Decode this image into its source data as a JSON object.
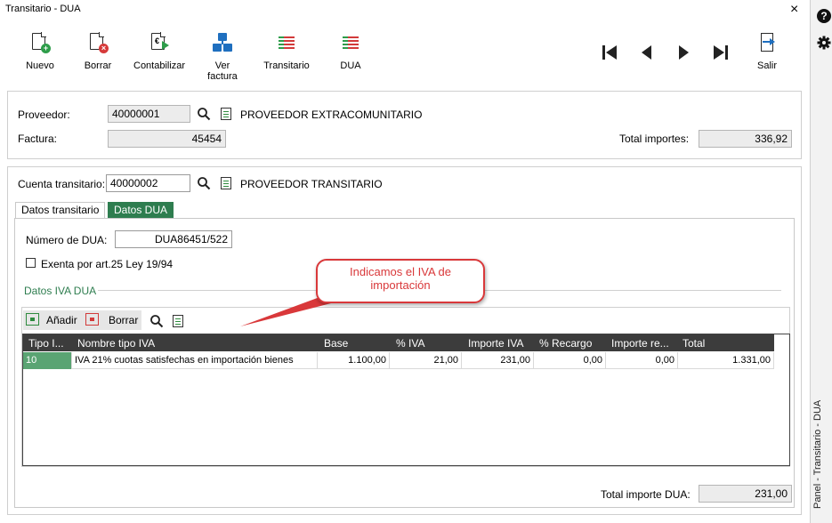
{
  "window": {
    "title": "Transitario - DUA",
    "close": "×"
  },
  "toolbar": {
    "nuevo": "Nuevo",
    "borrar": "Borrar",
    "contabilizar": "Contabilizar",
    "ver_factura": "Ver factura",
    "transitario": "Transitario",
    "dua": "DUA",
    "salir": "Salir"
  },
  "proveedor": {
    "label": "Proveedor:",
    "code": "40000001",
    "name": "PROVEEDOR EXTRACOMUNITARIO",
    "factura_label": "Factura:",
    "factura": "45454",
    "total_label": "Total importes:",
    "total": "336,92"
  },
  "transitario": {
    "label": "Cuenta transitario:",
    "code": "40000002",
    "name": "PROVEEDOR TRANSITARIO"
  },
  "tabs": [
    {
      "label": "Datos transitario",
      "active": false
    },
    {
      "label": "Datos DUA",
      "active": true
    }
  ],
  "dua": {
    "numero_label": "Número de DUA:",
    "numero": "DUA86451/522",
    "exenta_label": "Exenta por art.25 Ley 19/94",
    "exenta_checked": false,
    "section_label": "Datos IVA DUA"
  },
  "grid_toolbar": {
    "anadir": "Añadir",
    "borrar": "Borrar"
  },
  "grid": {
    "columns": [
      "Tipo I...",
      "Nombre tipo IVA",
      "Base",
      "% IVA",
      "Importe IVA",
      "% Recargo",
      "Importe re...",
      "Total"
    ],
    "rows": [
      [
        "10",
        "IVA 21% cuotas satisfechas en importación bienes",
        "1.100,00",
        "21,00",
        "231,00",
        "0,00",
        "0,00",
        "1.331,00"
      ]
    ]
  },
  "footer": {
    "total_label": "Total importe DUA:",
    "total": "231,00"
  },
  "callout": {
    "line1": "Indicamos el IVA de",
    "line2": "importación"
  },
  "side_panel": {
    "label": "Panel - Transitario - DUA",
    "help": "?"
  },
  "colors": {
    "accent": "#2e7d4f",
    "grid_header": "#3c3c3c",
    "callout": "#d9383a",
    "selected_cell": "#5aa473"
  }
}
